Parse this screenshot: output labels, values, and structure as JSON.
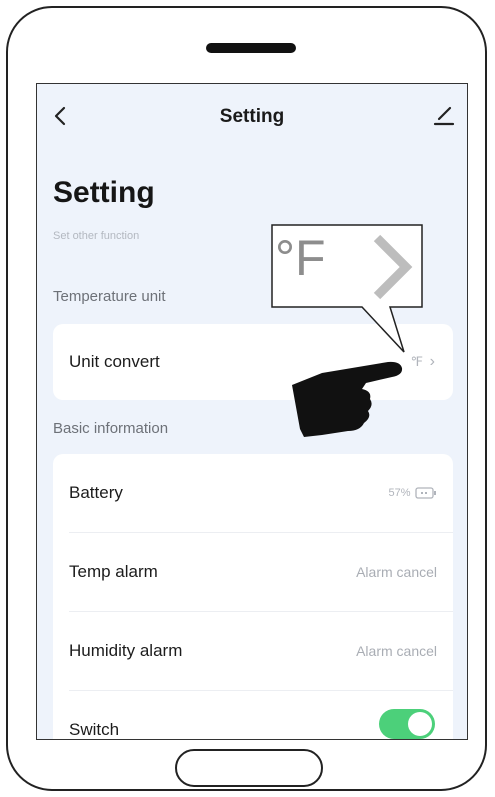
{
  "header": {
    "title": "Setting"
  },
  "page": {
    "title": "Setting",
    "subtitle": "Set other function"
  },
  "temperature_section": {
    "label": "Temperature unit",
    "unit_convert": {
      "label": "Unit convert",
      "value": "℉",
      "chevron": "›"
    }
  },
  "basic_section": {
    "label": "Basic information",
    "battery": {
      "label": "Battery",
      "value": "57%"
    },
    "temp_alarm": {
      "label": "Temp alarm",
      "value": "Alarm cancel"
    },
    "humidity_alarm": {
      "label": "Humidity alarm",
      "value": "Alarm cancel"
    },
    "switch": {
      "label": "Switch",
      "state": "on"
    }
  },
  "callout": {
    "text": "°F"
  },
  "colors": {
    "toggle_on": "#4cd07a",
    "screen_bg": "#eef3fb"
  }
}
